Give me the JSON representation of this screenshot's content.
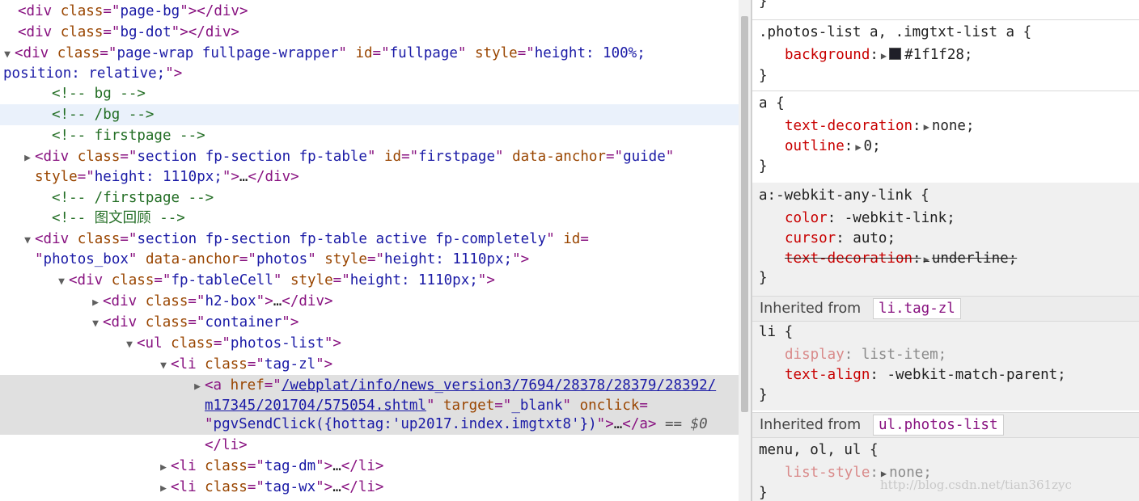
{
  "elements_panel": {
    "lines": [
      {
        "indent": 0,
        "arrow": "",
        "parts": [
          {
            "t": "tag",
            "v": "<div "
          },
          {
            "t": "attr",
            "v": "class"
          },
          {
            "t": "tag",
            "v": "=\""
          },
          {
            "t": "val",
            "v": "page-bg"
          },
          {
            "t": "tag",
            "v": "\"></div>"
          }
        ]
      },
      {
        "indent": 0,
        "arrow": "",
        "parts": [
          {
            "t": "tag",
            "v": "<div "
          },
          {
            "t": "attr",
            "v": "class"
          },
          {
            "t": "tag",
            "v": "=\""
          },
          {
            "t": "val",
            "v": "bg-dot"
          },
          {
            "t": "tag",
            "v": "\"></div>"
          }
        ]
      },
      {
        "indent": -1,
        "arrow": "▼",
        "parts": [
          {
            "t": "tag",
            "v": "<div "
          },
          {
            "t": "attr",
            "v": "class"
          },
          {
            "t": "tag",
            "v": "=\""
          },
          {
            "t": "val",
            "v": "page-wrap fullpage-wrapper"
          },
          {
            "t": "tag",
            "v": "\" "
          },
          {
            "t": "attr",
            "v": "id"
          },
          {
            "t": "tag",
            "v": "=\""
          },
          {
            "t": "val",
            "v": "fullpage"
          },
          {
            "t": "tag",
            "v": "\" "
          },
          {
            "t": "attr",
            "v": "style"
          },
          {
            "t": "tag",
            "v": "=\""
          },
          {
            "t": "val",
            "v": "height: 100%;"
          }
        ]
      },
      {
        "indent": -1,
        "arrow": "",
        "cont": true,
        "parts": [
          {
            "t": "val",
            "v": "position: relative;"
          },
          {
            "t": "tag",
            "v": "\">"
          }
        ]
      },
      {
        "indent": 1,
        "arrow": "",
        "parts": [
          {
            "t": "cmt",
            "v": "<!-- bg -->"
          }
        ]
      },
      {
        "indent": 1,
        "arrow": "",
        "hl": "soft",
        "parts": [
          {
            "t": "cmt",
            "v": "<!-- /bg -->"
          }
        ]
      },
      {
        "indent": 1,
        "arrow": "",
        "parts": [
          {
            "t": "cmt",
            "v": "<!--  firstpage -->"
          }
        ]
      },
      {
        "indent": 0.5,
        "arrow": "▶",
        "parts": [
          {
            "t": "tag",
            "v": "<div "
          },
          {
            "t": "attr",
            "v": "class"
          },
          {
            "t": "tag",
            "v": "=\""
          },
          {
            "t": "val",
            "v": "section fp-section fp-table"
          },
          {
            "t": "tag",
            "v": "\" "
          },
          {
            "t": "attr",
            "v": "id"
          },
          {
            "t": "tag",
            "v": "=\""
          },
          {
            "t": "val",
            "v": "firstpage"
          },
          {
            "t": "tag",
            "v": "\" "
          },
          {
            "t": "attr",
            "v": "data-anchor"
          },
          {
            "t": "tag",
            "v": "=\""
          },
          {
            "t": "val",
            "v": "guide"
          },
          {
            "t": "tag",
            "v": "\""
          }
        ]
      },
      {
        "indent": 0.5,
        "arrow": "",
        "cont": true,
        "parts": [
          {
            "t": "attr",
            "v": "style"
          },
          {
            "t": "tag",
            "v": "=\""
          },
          {
            "t": "val",
            "v": "height: 1110px;"
          },
          {
            "t": "tag",
            "v": "\">"
          },
          {
            "t": "txt",
            "v": "…"
          },
          {
            "t": "tag",
            "v": "</div>"
          }
        ]
      },
      {
        "indent": 1,
        "arrow": "",
        "parts": [
          {
            "t": "cmt",
            "v": "<!--  /firstpage -->"
          }
        ]
      },
      {
        "indent": 1,
        "arrow": "",
        "parts": [
          {
            "t": "cmt",
            "v": "<!-- 图文回顾 -->"
          }
        ]
      },
      {
        "indent": 0.5,
        "arrow": "▼",
        "parts": [
          {
            "t": "tag",
            "v": "<div "
          },
          {
            "t": "attr",
            "v": "class"
          },
          {
            "t": "tag",
            "v": "=\""
          },
          {
            "t": "val",
            "v": "section fp-section fp-table active fp-completely"
          },
          {
            "t": "tag",
            "v": "\" "
          },
          {
            "t": "attr",
            "v": "id"
          },
          {
            "t": "tag",
            "v": "="
          }
        ]
      },
      {
        "indent": 0.5,
        "arrow": "",
        "cont": true,
        "parts": [
          {
            "t": "tag",
            "v": "\""
          },
          {
            "t": "val",
            "v": "photos_box"
          },
          {
            "t": "tag",
            "v": "\" "
          },
          {
            "t": "attr",
            "v": "data-anchor"
          },
          {
            "t": "tag",
            "v": "=\""
          },
          {
            "t": "val",
            "v": "photos"
          },
          {
            "t": "tag",
            "v": "\" "
          },
          {
            "t": "attr",
            "v": "style"
          },
          {
            "t": "tag",
            "v": "=\""
          },
          {
            "t": "val",
            "v": "height: 1110px;"
          },
          {
            "t": "tag",
            "v": "\">"
          }
        ]
      },
      {
        "indent": 1.5,
        "arrow": "▼",
        "parts": [
          {
            "t": "tag",
            "v": "<div "
          },
          {
            "t": "attr",
            "v": "class"
          },
          {
            "t": "tag",
            "v": "=\""
          },
          {
            "t": "val",
            "v": "fp-tableCell"
          },
          {
            "t": "tag",
            "v": "\" "
          },
          {
            "t": "attr",
            "v": "style"
          },
          {
            "t": "tag",
            "v": "=\""
          },
          {
            "t": "val",
            "v": "height: 1110px;"
          },
          {
            "t": "tag",
            "v": "\">"
          }
        ]
      },
      {
        "indent": 2.5,
        "arrow": "▶",
        "parts": [
          {
            "t": "tag",
            "v": "<div "
          },
          {
            "t": "attr",
            "v": "class"
          },
          {
            "t": "tag",
            "v": "=\""
          },
          {
            "t": "val",
            "v": "h2-box"
          },
          {
            "t": "tag",
            "v": "\">"
          },
          {
            "t": "txt",
            "v": "…"
          },
          {
            "t": "tag",
            "v": "</div>"
          }
        ]
      },
      {
        "indent": 2.5,
        "arrow": "▼",
        "parts": [
          {
            "t": "tag",
            "v": "<div "
          },
          {
            "t": "attr",
            "v": "class"
          },
          {
            "t": "tag",
            "v": "=\""
          },
          {
            "t": "val",
            "v": "container"
          },
          {
            "t": "tag",
            "v": "\">"
          }
        ]
      },
      {
        "indent": 3.5,
        "arrow": "▼",
        "parts": [
          {
            "t": "tag",
            "v": "<ul "
          },
          {
            "t": "attr",
            "v": "class"
          },
          {
            "t": "tag",
            "v": "=\""
          },
          {
            "t": "val",
            "v": "photos-list"
          },
          {
            "t": "tag",
            "v": "\">"
          }
        ]
      },
      {
        "indent": 4.5,
        "arrow": "▼",
        "parts": [
          {
            "t": "tag",
            "v": "<li "
          },
          {
            "t": "attr",
            "v": "class"
          },
          {
            "t": "tag",
            "v": "=\""
          },
          {
            "t": "val",
            "v": "tag-zl"
          },
          {
            "t": "tag",
            "v": "\">"
          }
        ]
      },
      {
        "indent": 5.5,
        "arrow": "▶",
        "hl": "sel",
        "parts": [
          {
            "t": "tag",
            "v": "<a "
          },
          {
            "t": "attr",
            "v": "href"
          },
          {
            "t": "tag",
            "v": "=\""
          },
          {
            "t": "link",
            "v": "/webplat/info/news_version3/7694/28378/28379/28392/"
          }
        ]
      },
      {
        "indent": 5.5,
        "arrow": "",
        "cont": true,
        "hl": "sel",
        "parts": [
          {
            "t": "link",
            "v": "m17345/201704/575054.shtml"
          },
          {
            "t": "tag",
            "v": "\" "
          },
          {
            "t": "attr",
            "v": "target"
          },
          {
            "t": "tag",
            "v": "=\""
          },
          {
            "t": "val",
            "v": "_blank"
          },
          {
            "t": "tag",
            "v": "\" "
          },
          {
            "t": "attr",
            "v": "onclick"
          },
          {
            "t": "tag",
            "v": "="
          }
        ]
      },
      {
        "indent": 5.5,
        "arrow": "",
        "cont": true,
        "hl": "sel",
        "parts": [
          {
            "t": "tag",
            "v": "\""
          },
          {
            "t": "val",
            "v": "pgvSendClick({hottag:'up2017.index.imgtxt8'})"
          },
          {
            "t": "tag",
            "v": "\">"
          },
          {
            "t": "txt",
            "v": "…"
          },
          {
            "t": "tag",
            "v": "</a>"
          },
          {
            "t": "sel",
            "v": " == $0"
          }
        ]
      },
      {
        "indent": 5.5,
        "arrow": "",
        "cont": true,
        "parts": [
          {
            "t": "tag",
            "v": "</li>"
          }
        ]
      },
      {
        "indent": 4.5,
        "arrow": "▶",
        "parts": [
          {
            "t": "tag",
            "v": "<li "
          },
          {
            "t": "attr",
            "v": "class"
          },
          {
            "t": "tag",
            "v": "=\""
          },
          {
            "t": "val",
            "v": "tag-dm"
          },
          {
            "t": "tag",
            "v": "\">"
          },
          {
            "t": "txt",
            "v": "…"
          },
          {
            "t": "tag",
            "v": "</li>"
          }
        ]
      },
      {
        "indent": 4.5,
        "arrow": "▶",
        "parts": [
          {
            "t": "tag",
            "v": "<li "
          },
          {
            "t": "attr",
            "v": "class"
          },
          {
            "t": "tag",
            "v": "=\""
          },
          {
            "t": "val",
            "v": "tag-wx"
          },
          {
            "t": "tag",
            "v": "\">"
          },
          {
            "t": "txt",
            "v": "…"
          },
          {
            "t": "tag",
            "v": "</li>"
          }
        ]
      }
    ]
  },
  "styles_panel": {
    "top_brace": "}",
    "rules": [
      {
        "selector": ".photos-list a, .imgtxt-list a {",
        "decls": [
          {
            "name": "background",
            "value": "#1f1f28",
            "swatch": "#1f1f28"
          }
        ],
        "close": "}"
      },
      {
        "selector": "a {",
        "decls": [
          {
            "name": "text-decoration",
            "value": "none"
          },
          {
            "name": "outline",
            "value": "0"
          }
        ],
        "close": "}"
      },
      {
        "selector": "a:-webkit-any-link {",
        "decls": [
          {
            "name": "color",
            "value": "-webkit-link"
          },
          {
            "name": "cursor",
            "value": "auto"
          },
          {
            "name": "text-decoration",
            "value": "underline",
            "struck": true
          }
        ],
        "close": "}"
      }
    ],
    "inherited_1": {
      "label": "Inherited from",
      "chip": "li.tag-zl"
    },
    "rule_li": {
      "selector": "li {",
      "decls": [
        {
          "name": "display",
          "value": "list-item",
          "faded": true
        },
        {
          "name": "text-align",
          "value": "-webkit-match-parent"
        }
      ],
      "close": "}"
    },
    "inherited_2": {
      "label": "Inherited from",
      "chip": "ul.photos-list"
    },
    "rule_menu": {
      "selector": "menu, ol, ul {",
      "decls": [
        {
          "name": "list-style",
          "value": "none",
          "faded": true
        }
      ],
      "close": "}"
    }
  },
  "watermark": "http://blog.csdn.net/tian361zyc"
}
